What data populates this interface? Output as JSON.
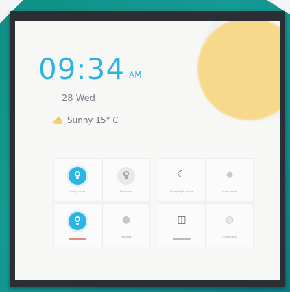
{
  "clock": {
    "time": "09:34",
    "ampm": "AM",
    "date": "28 Wed"
  },
  "weather": {
    "icon": "partly-sunny-icon",
    "text": "Sunny 15° C"
  },
  "colors": {
    "accent": "#2bb3e6",
    "sun": "#f7d98c",
    "backdrop": "#129589",
    "frame": "#2b2f33"
  },
  "tiles": [
    {
      "label": "Living room",
      "icon": "lightbulb-icon",
      "state": "on"
    },
    {
      "label": "Bedroom",
      "icon": "lightbulb-icon",
      "state": "off"
    },
    {
      "label": "Good night mode",
      "icon": "moon-icon",
      "state": "idle"
    },
    {
      "label": "Away mode",
      "icon": "diamond-icon",
      "state": "idle"
    },
    {
      "label": "Kitchen",
      "icon": "lightbulb-icon",
      "state": "on"
    },
    {
      "label": "Hallway",
      "icon": "dot-icon",
      "state": "idle"
    },
    {
      "label": "Curtains",
      "icon": "curtain-icon",
      "state": "idle"
    },
    {
      "label": "Thermostat",
      "icon": "dial-icon",
      "state": "idle"
    }
  ]
}
